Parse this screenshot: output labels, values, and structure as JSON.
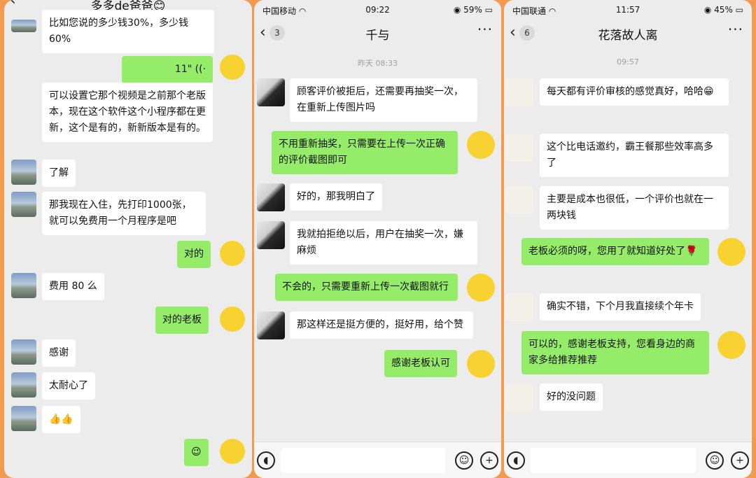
{
  "panel1": {
    "title": "多多de爸爸😊",
    "messages": [
      {
        "side": "left",
        "text": "比如您说的多少钱30%，多少钱60%"
      },
      {
        "side": "right",
        "text": "11\" ((·"
      },
      {
        "side": "left",
        "text": "可以设置它那个视频是之前那个老版本，现在这个软件这个小程序都在更新，这个是有的，新新版本是有的。"
      },
      {
        "side": "left",
        "text": "了解"
      },
      {
        "side": "left",
        "text": "那我现在入住，先打印1000张，就可以免费用一个月程序是吧"
      },
      {
        "side": "right",
        "text": "对的"
      },
      {
        "side": "left",
        "text": "费用 80 么"
      },
      {
        "side": "right",
        "text": "对的老板"
      },
      {
        "side": "left",
        "text": "感谢"
      },
      {
        "side": "left",
        "text": "太耐心了"
      },
      {
        "side": "left",
        "text": "👍👍"
      },
      {
        "side": "right",
        "text": "😉"
      }
    ]
  },
  "panel2": {
    "carrier": "中国移动",
    "time": "09:22",
    "battery": "59%",
    "back_count": "3",
    "title": "千与",
    "timestamp": "昨天 08:33",
    "messages": [
      {
        "side": "left",
        "text": "顾客评价被拒后，还需要再抽奖一次，在重新上传图片吗"
      },
      {
        "side": "right",
        "text": "不用重新抽奖，只需要在上传一次正确的评价截图即可"
      },
      {
        "side": "left",
        "text": "好的，那我明白了"
      },
      {
        "side": "left",
        "text": "我就拍拒绝以后，用户在抽奖一次，嫌麻烦"
      },
      {
        "side": "right",
        "text": "不会的，只需要重新上传一次截图就行"
      },
      {
        "side": "left",
        "text": "那这样还是挺方便的，挺好用，给个赞"
      },
      {
        "side": "right",
        "text": "感谢老板认可"
      }
    ]
  },
  "panel3": {
    "carrier": "中国联通",
    "time": "11:57",
    "battery": "45%",
    "back_count": "6",
    "title": "花落故人离",
    "timestamp": "09:57",
    "messages": [
      {
        "side": "left",
        "text": "每天都有评价审核的感觉真好，哈哈😁"
      },
      {
        "side": "left",
        "text": "这个比电话邀约，霸王餐那些效率高多了"
      },
      {
        "side": "left",
        "text": "主要是成本也很低，一个评价也就在一两块钱"
      },
      {
        "side": "right",
        "text": "老板必须的呀，您用了就知道好处了🌹"
      },
      {
        "side": "left",
        "text": "确实不错，下个月我直接续个年卡"
      },
      {
        "side": "right",
        "text": "可以的，感谢老板支持，您看身边的商家多给推荐推荐"
      },
      {
        "side": "left",
        "text": "好的没问题"
      }
    ]
  },
  "icons": [
    "back-chevron-icon",
    "more-dots-icon",
    "voice-icon",
    "emoji-icon",
    "plus-icon",
    "wifi-icon",
    "lock-rotation-icon"
  ],
  "colors": {
    "background_frame": "#f29a4f",
    "chat_bg": "#ececec",
    "bubble_self": "#95ec69",
    "bubble_other": "#ffffff"
  }
}
